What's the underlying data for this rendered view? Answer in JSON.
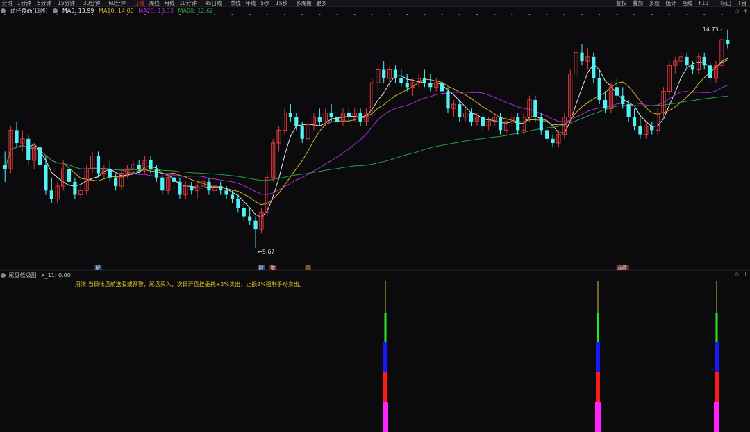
{
  "toolbar": {
    "left_items": [
      "分时",
      "1分钟",
      "5分钟",
      "15分钟",
      "30分钟",
      "60分钟",
      "日线",
      "周线",
      "月线",
      "10分钟",
      "45日线",
      "季线",
      "年线",
      "5秒",
      "15秒",
      "多周期",
      "更多"
    ],
    "active": "日线",
    "right_items": [
      "复权",
      "叠加",
      "多股",
      "统计",
      "画线",
      "F10",
      "标记",
      "+自"
    ]
  },
  "legend": {
    "stock": "劲仔食品(日线)",
    "ma5": "MA5: 13.99",
    "ma10": "MA10: 14.00",
    "ma20": "MA20: 13.33",
    "ma60": "MA60: 12.62"
  },
  "colors": {
    "up": "#e0393e",
    "down": "#54f2f4",
    "ma5": "#e8e8e8",
    "ma10": "#d6b228",
    "ma20": "#b42bd8",
    "ma60": "#26a046",
    "signal_yellow": "#d4c13a",
    "signal_green": "#23e82b",
    "signal_blue": "#1818ff",
    "signal_red": "#ff1a1a",
    "signal_magenta": "#ff22ff"
  },
  "lower": {
    "title": "尾盘低吸副",
    "value": "X_11: 0.00",
    "usage": "用法:当日收盘前选股或预警，尾盘买入，次日开盘挂委托+2%卖出，止损2%强制手动卖出。"
  },
  "chart_data": {
    "type": "candlestick",
    "title": "劲仔食品(日线)",
    "price_range": [
      9.2,
      15.0
    ],
    "high_label": "14.73",
    "low_label": "9.67",
    "event_markers": [
      "解",
      "财",
      "增",
      "",
      "业绩"
    ],
    "ma_series": [
      {
        "name": "MA5",
        "last": 13.99
      },
      {
        "name": "MA10",
        "last": 14.0
      },
      {
        "name": "MA20",
        "last": 13.33
      },
      {
        "name": "MA60",
        "last": 12.62
      }
    ],
    "candles": [
      [
        11.6,
        11.9,
        11.2,
        11.5
      ],
      [
        11.5,
        12.5,
        11.4,
        12.4
      ],
      [
        12.4,
        12.6,
        12.0,
        12.1
      ],
      [
        12.1,
        12.4,
        11.9,
        12.2
      ],
      [
        12.2,
        12.3,
        11.6,
        11.7
      ],
      [
        11.7,
        12.1,
        11.5,
        12.0
      ],
      [
        12.0,
        12.1,
        11.5,
        11.6
      ],
      [
        11.6,
        11.8,
        10.9,
        11.0
      ],
      [
        11.0,
        11.3,
        10.7,
        10.8
      ],
      [
        10.8,
        11.2,
        10.7,
        11.1
      ],
      [
        11.1,
        11.7,
        11.0,
        11.5
      ],
      [
        11.5,
        11.6,
        11.1,
        11.2
      ],
      [
        11.2,
        11.3,
        10.8,
        10.9
      ],
      [
        10.9,
        11.1,
        10.8,
        11.0
      ],
      [
        11.0,
        11.6,
        10.9,
        11.5
      ],
      [
        11.5,
        11.9,
        11.4,
        11.8
      ],
      [
        11.8,
        11.9,
        11.3,
        11.4
      ],
      [
        11.4,
        11.6,
        11.3,
        11.5
      ],
      [
        11.5,
        11.7,
        11.2,
        11.3
      ],
      [
        11.3,
        11.4,
        11.0,
        11.1
      ],
      [
        11.1,
        11.5,
        11.0,
        11.4
      ],
      [
        11.4,
        11.6,
        11.3,
        11.5
      ],
      [
        11.5,
        11.7,
        11.4,
        11.6
      ],
      [
        11.6,
        11.7,
        11.4,
        11.5
      ],
      [
        11.5,
        11.8,
        11.4,
        11.7
      ],
      [
        11.7,
        11.8,
        11.4,
        11.5
      ],
      [
        11.5,
        11.6,
        11.2,
        11.3
      ],
      [
        11.3,
        11.4,
        10.9,
        11.0
      ],
      [
        11.0,
        11.4,
        10.9,
        11.3
      ],
      [
        11.3,
        11.4,
        11.1,
        11.2
      ],
      [
        11.2,
        11.3,
        10.8,
        10.9
      ],
      [
        10.9,
        11.2,
        10.8,
        11.1
      ],
      [
        11.1,
        11.2,
        10.9,
        11.0
      ],
      [
        11.0,
        11.2,
        10.8,
        11.1
      ],
      [
        11.1,
        11.3,
        11.0,
        11.2
      ],
      [
        11.2,
        11.3,
        10.9,
        11.0
      ],
      [
        11.0,
        11.2,
        10.9,
        11.1
      ],
      [
        11.1,
        11.2,
        10.9,
        11.0
      ],
      [
        11.0,
        11.1,
        10.8,
        10.9
      ],
      [
        10.9,
        11.0,
        10.7,
        10.8
      ],
      [
        10.8,
        10.9,
        10.5,
        10.6
      ],
      [
        10.6,
        10.7,
        10.3,
        10.4
      ],
      [
        10.4,
        10.6,
        10.2,
        10.3
      ],
      [
        10.3,
        10.4,
        9.67,
        10.1
      ],
      [
        10.1,
        10.6,
        10.0,
        10.5
      ],
      [
        10.5,
        11.4,
        10.4,
        11.3
      ],
      [
        11.3,
        12.2,
        11.2,
        12.1
      ],
      [
        12.1,
        12.5,
        11.9,
        12.4
      ],
      [
        12.4,
        12.9,
        12.3,
        12.8
      ],
      [
        12.8,
        13.0,
        12.6,
        12.7
      ],
      [
        12.7,
        12.8,
        12.4,
        12.5
      ],
      [
        12.5,
        12.6,
        12.1,
        12.2
      ],
      [
        12.2,
        12.6,
        12.1,
        12.5
      ],
      [
        12.5,
        12.8,
        12.4,
        12.7
      ],
      [
        12.7,
        12.9,
        12.5,
        12.6
      ],
      [
        12.6,
        12.9,
        12.5,
        12.8
      ],
      [
        12.8,
        13.0,
        12.6,
        12.7
      ],
      [
        12.7,
        12.8,
        12.5,
        12.6
      ],
      [
        12.6,
        12.9,
        12.5,
        12.8
      ],
      [
        12.8,
        12.9,
        12.6,
        12.7
      ],
      [
        12.7,
        12.9,
        12.6,
        12.8
      ],
      [
        12.8,
        12.9,
        12.5,
        12.6
      ],
      [
        12.6,
        12.9,
        12.5,
        12.8
      ],
      [
        12.8,
        13.6,
        12.7,
        13.5
      ],
      [
        13.5,
        13.9,
        13.3,
        13.8
      ],
      [
        13.8,
        14.0,
        13.5,
        13.6
      ],
      [
        13.6,
        13.9,
        13.4,
        13.8
      ],
      [
        13.8,
        13.9,
        13.5,
        13.6
      ],
      [
        13.6,
        13.8,
        13.4,
        13.5
      ],
      [
        13.5,
        13.7,
        13.3,
        13.4
      ],
      [
        13.4,
        13.6,
        13.2,
        13.5
      ],
      [
        13.5,
        13.7,
        13.4,
        13.6
      ],
      [
        13.6,
        13.8,
        13.4,
        13.5
      ],
      [
        13.5,
        13.7,
        13.3,
        13.4
      ],
      [
        13.4,
        13.6,
        13.3,
        13.5
      ],
      [
        13.5,
        13.6,
        13.2,
        13.3
      ],
      [
        13.3,
        13.4,
        12.8,
        12.9
      ],
      [
        12.9,
        13.1,
        12.7,
        13.0
      ],
      [
        13.0,
        13.1,
        12.6,
        12.7
      ],
      [
        12.7,
        12.9,
        12.6,
        12.8
      ],
      [
        12.8,
        12.9,
        12.5,
        12.6
      ],
      [
        12.6,
        12.8,
        12.5,
        12.7
      ],
      [
        12.7,
        12.8,
        12.4,
        12.5
      ],
      [
        12.5,
        12.7,
        12.4,
        12.6
      ],
      [
        12.6,
        12.8,
        12.5,
        12.7
      ],
      [
        12.7,
        12.8,
        12.3,
        12.4
      ],
      [
        12.4,
        12.7,
        12.3,
        12.6
      ],
      [
        12.6,
        12.8,
        12.5,
        12.7
      ],
      [
        12.7,
        12.8,
        12.3,
        12.4
      ],
      [
        12.4,
        12.8,
        12.3,
        12.7
      ],
      [
        12.7,
        13.2,
        12.6,
        13.1
      ],
      [
        13.1,
        13.2,
        12.6,
        12.7
      ],
      [
        12.7,
        12.8,
        12.3,
        12.4
      ],
      [
        12.4,
        12.5,
        12.1,
        12.2
      ],
      [
        12.2,
        12.3,
        12.0,
        12.1
      ],
      [
        12.1,
        12.4,
        12.0,
        12.3
      ],
      [
        12.3,
        12.8,
        12.2,
        12.7
      ],
      [
        12.7,
        13.8,
        12.6,
        13.7
      ],
      [
        13.7,
        14.3,
        13.6,
        14.2
      ],
      [
        14.2,
        14.4,
        13.9,
        14.0
      ],
      [
        14.0,
        14.3,
        13.8,
        14.1
      ],
      [
        14.1,
        14.2,
        13.5,
        13.6
      ],
      [
        13.6,
        13.8,
        13.0,
        13.1
      ],
      [
        13.1,
        13.3,
        12.8,
        12.9
      ],
      [
        12.9,
        13.5,
        12.8,
        13.4
      ],
      [
        13.4,
        13.6,
        13.1,
        13.2
      ],
      [
        13.2,
        13.4,
        12.9,
        13.0
      ],
      [
        13.0,
        13.1,
        12.6,
        12.7
      ],
      [
        12.7,
        12.9,
        12.4,
        12.5
      ],
      [
        12.5,
        12.7,
        12.2,
        12.3
      ],
      [
        12.3,
        12.6,
        12.2,
        12.5
      ],
      [
        12.5,
        12.6,
        12.3,
        12.4
      ],
      [
        12.4,
        12.9,
        12.3,
        12.8
      ],
      [
        12.8,
        13.4,
        12.7,
        13.3
      ],
      [
        13.3,
        14.0,
        13.2,
        13.9
      ],
      [
        13.9,
        14.1,
        13.7,
        14.0
      ],
      [
        14.0,
        14.2,
        13.8,
        14.1
      ],
      [
        14.1,
        14.2,
        13.8,
        13.9
      ],
      [
        13.9,
        14.0,
        13.7,
        13.8
      ],
      [
        13.8,
        14.2,
        13.7,
        14.1
      ],
      [
        14.1,
        14.2,
        13.8,
        13.9
      ],
      [
        13.9,
        14.0,
        13.5,
        13.6
      ],
      [
        13.6,
        14.0,
        13.5,
        13.9
      ],
      [
        13.9,
        14.6,
        13.8,
        14.5
      ],
      [
        14.5,
        14.73,
        14.3,
        14.4
      ]
    ]
  }
}
